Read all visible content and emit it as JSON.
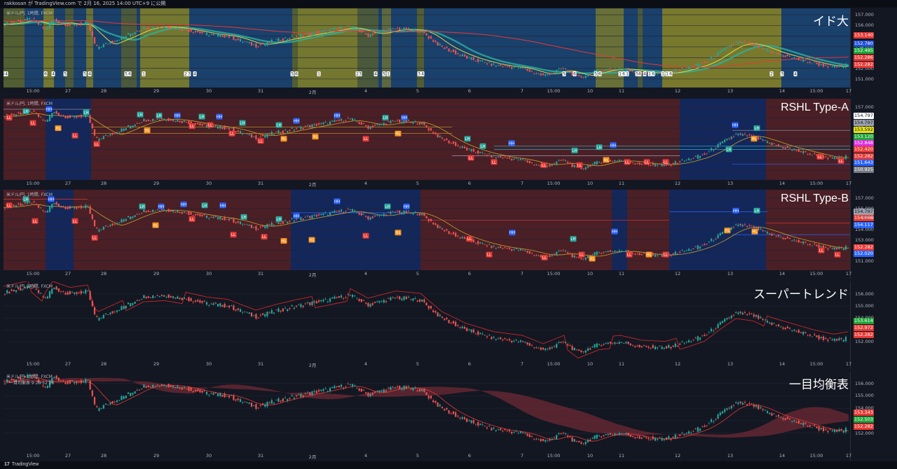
{
  "header": {
    "publish_text": "rakkosan が TradingView.com で 2月 16, 2025 14:00 UTC+9 に公開"
  },
  "footer": {
    "brand_mark": "17",
    "brand": "TradingView"
  },
  "x_axis": [
    "15:00",
    "27",
    "28",
    "29",
    "30",
    "31",
    "2月",
    "4",
    "5",
    "6",
    "7",
    "15:00",
    "10",
    "11",
    "12",
    "13",
    "14",
    "15:00",
    "17"
  ],
  "panes": [
    {
      "title": "イド大",
      "symbol": "米ドル/円, 1時間, FXCM",
      "y_ticks": [
        "157.000",
        "156.000",
        "155.000",
        "154.000",
        "153.000",
        "152.000",
        "151.000"
      ],
      "price_tags": [
        {
          "value": "153.140",
          "color": "#e53935"
        },
        {
          "value": "152.780",
          "color": "#1e4fd8"
        },
        {
          "value": "152.495",
          "color": "#22a33a"
        },
        {
          "value": "152.286",
          "color": "#e53935"
        },
        {
          "value": "152.282",
          "color": "#e53935"
        }
      ],
      "markers": [
        {
          "t": 1,
          "label": "4"
        },
        {
          "t": 4,
          "label": "4"
        },
        {
          "t": 60,
          "label": "6"
        },
        {
          "t": 71,
          "label": "4"
        },
        {
          "t": 88,
          "label": "5"
        },
        {
          "t": 116,
          "label": "5"
        },
        {
          "t": 123,
          "label": "4"
        },
        {
          "t": 175,
          "label": "5"
        },
        {
          "t": 180,
          "label": "6"
        },
        {
          "t": 200,
          "label": "1"
        },
        {
          "t": 260,
          "label": "2"
        },
        {
          "t": 265,
          "label": "3"
        },
        {
          "t": 273,
          "label": "4"
        },
        {
          "t": 412,
          "label": "5"
        },
        {
          "t": 418,
          "label": "6"
        },
        {
          "t": 450,
          "label": "1"
        },
        {
          "t": 505,
          "label": "2"
        },
        {
          "t": 509,
          "label": "3"
        },
        {
          "t": 531,
          "label": "4"
        },
        {
          "t": 543,
          "label": "5"
        },
        {
          "t": 549,
          "label": "1"
        },
        {
          "t": 593,
          "label": "3"
        },
        {
          "t": 598,
          "label": "4"
        },
        {
          "t": 800,
          "label": "5"
        },
        {
          "t": 815,
          "label": "6"
        },
        {
          "t": 845,
          "label": "5"
        },
        {
          "t": 851,
          "label": "6"
        },
        {
          "t": 880,
          "label": "1"
        },
        {
          "t": 885,
          "label": "6"
        },
        {
          "t": 890,
          "label": "1"
        },
        {
          "t": 904,
          "label": "5"
        },
        {
          "t": 908,
          "label": "6"
        },
        {
          "t": 915,
          "label": "4"
        },
        {
          "t": 922,
          "label": "1"
        },
        {
          "t": 927,
          "label": "6"
        },
        {
          "t": 941,
          "label": "1"
        },
        {
          "t": 947,
          "label": "1"
        },
        {
          "t": 952,
          "label": "6"
        },
        {
          "t": 1096,
          "label": "2"
        },
        {
          "t": 1111,
          "label": "3"
        },
        {
          "t": 1130,
          "label": "4"
        }
      ]
    },
    {
      "title": "RSHL Type-A",
      "symbol": "米ドル/円, 1時間, FXCM",
      "y_ticks": [
        "157.000",
        "156.000",
        "155.000",
        "154.000",
        "153.000",
        "152.000",
        "151.000"
      ],
      "price_tags": [
        {
          "value": "154.797",
          "color": "#ffffff",
          "text": "#131722"
        },
        {
          "value": "154.797",
          "color": "#9aa0ac",
          "text": "#131722"
        },
        {
          "value": "153.592",
          "color": "#e6e21a",
          "text": "#131722"
        },
        {
          "value": "153.120",
          "color": "#22a33a"
        },
        {
          "value": "152.848",
          "color": "#d930d9"
        },
        {
          "value": "152.420",
          "color": "#e53935"
        },
        {
          "value": "152.282",
          "color": "#e53935"
        },
        {
          "value": "151.643",
          "color": "#2962ff"
        },
        {
          "value": "150.925",
          "color": "#787b86"
        }
      ],
      "labels": [
        {
          "t": 8,
          "y": 156.0,
          "text": "LL"
        },
        {
          "t": 32,
          "y": 156.6,
          "text": "LH"
        },
        {
          "t": 42,
          "y": 155.5,
          "text": "LL"
        },
        {
          "t": 65,
          "y": 156.8,
          "text": "HH"
        },
        {
          "t": 78,
          "y": 155.0,
          "text": "HL"
        },
        {
          "t": 102,
          "y": 154.3,
          "text": "LL"
        },
        {
          "t": 118,
          "y": 156.5,
          "text": "LH"
        },
        {
          "t": 133,
          "y": 153.5,
          "text": "LL"
        },
        {
          "t": 195,
          "y": 156.3,
          "text": "LH"
        },
        {
          "t": 205,
          "y": 154.8,
          "text": "HL"
        },
        {
          "t": 222,
          "y": 156.2,
          "text": "LH"
        },
        {
          "t": 248,
          "y": 156.2,
          "text": "HH"
        },
        {
          "t": 269,
          "y": 155.2,
          "text": "LL"
        },
        {
          "t": 283,
          "y": 156.1,
          "text": "LH"
        },
        {
          "t": 295,
          "y": 155.3,
          "text": "LL"
        },
        {
          "t": 308,
          "y": 156.1,
          "text": "HH"
        },
        {
          "t": 326,
          "y": 154.5,
          "text": "LL"
        },
        {
          "t": 341,
          "y": 155.5,
          "text": "LH"
        },
        {
          "t": 367,
          "y": 153.8,
          "text": "LL"
        },
        {
          "t": 393,
          "y": 155.3,
          "text": "LH"
        },
        {
          "t": 400,
          "y": 154.0,
          "text": "HL"
        },
        {
          "t": 418,
          "y": 155.7,
          "text": "HH"
        },
        {
          "t": 445,
          "y": 154.2,
          "text": "HL"
        },
        {
          "t": 476,
          "y": 156.2,
          "text": "HH"
        },
        {
          "t": 517,
          "y": 154.0,
          "text": "LL"
        },
        {
          "t": 545,
          "y": 156.0,
          "text": "LH"
        },
        {
          "t": 563,
          "y": 154.5,
          "text": "HL"
        },
        {
          "t": 572,
          "y": 156.0,
          "text": "HH"
        },
        {
          "t": 662,
          "y": 154.0,
          "text": "LH"
        },
        {
          "t": 667,
          "y": 152.2,
          "text": "LL"
        },
        {
          "t": 684,
          "y": 153.3,
          "text": "LH"
        },
        {
          "t": 700,
          "y": 151.8,
          "text": "LL"
        },
        {
          "t": 725,
          "y": 153.6,
          "text": "HH"
        },
        {
          "t": 771,
          "y": 151.5,
          "text": "LL"
        },
        {
          "t": 815,
          "y": 152.9,
          "text": "LH"
        },
        {
          "t": 822,
          "y": 151.5,
          "text": "LL"
        },
        {
          "t": 850,
          "y": 153.2,
          "text": "LH"
        },
        {
          "t": 860,
          "y": 152.0,
          "text": "HL"
        },
        {
          "t": 870,
          "y": 153.4,
          "text": "HH"
        },
        {
          "t": 890,
          "y": 151.8,
          "text": "LL"
        },
        {
          "t": 918,
          "y": 151.8,
          "text": "LL"
        },
        {
          "t": 945,
          "y": 151.8,
          "text": "LL"
        },
        {
          "t": 1044,
          "y": 155.3,
          "text": "HH"
        },
        {
          "t": 1035,
          "y": 153.0,
          "text": "LH"
        },
        {
          "t": 1071,
          "y": 154.0,
          "text": "HL"
        },
        {
          "t": 1075,
          "y": 155.0,
          "text": "LH"
        },
        {
          "t": 1165,
          "y": 152.3,
          "text": "LL"
        },
        {
          "t": 1195,
          "y": 151.9,
          "text": "LL"
        }
      ]
    },
    {
      "title": "RSHL Type-B",
      "symbol": "米ドル/円, 1時間, FXCM",
      "y_ticks": [
        "157.000",
        "156.000",
        "155.000",
        "154.000",
        "153.000",
        "152.000",
        "151.000"
      ],
      "price_tags": [
        {
          "value": "154.797",
          "color": "#9aa0ac",
          "text": "#131722"
        },
        {
          "value": "154.666",
          "color": "#e53935"
        },
        {
          "value": "154.117",
          "color": "#2962ff"
        },
        {
          "value": "152.282",
          "color": "#e53935"
        },
        {
          "value": "152.020",
          "color": "#2962ff"
        }
      ],
      "cursor_value": "238.4",
      "labels": [
        {
          "t": 8,
          "y": 156.3,
          "text": "LL"
        },
        {
          "t": 32,
          "y": 156.9,
          "text": "LH"
        },
        {
          "t": 45,
          "y": 154.8,
          "text": "LL"
        },
        {
          "t": 68,
          "y": 156.9,
          "text": "HH"
        },
        {
          "t": 102,
          "y": 154.8,
          "text": "LL"
        },
        {
          "t": 130,
          "y": 153.2,
          "text": "LL"
        },
        {
          "t": 198,
          "y": 156.2,
          "text": "LH"
        },
        {
          "t": 217,
          "y": 154.4,
          "text": "HL"
        },
        {
          "t": 225,
          "y": 156.2,
          "text": "HH"
        },
        {
          "t": 257,
          "y": 156.4,
          "text": "HH"
        },
        {
          "t": 269,
          "y": 155.0,
          "text": "LL"
        },
        {
          "t": 287,
          "y": 156.3,
          "text": "LH"
        },
        {
          "t": 313,
          "y": 156.3,
          "text": "HH"
        },
        {
          "t": 328,
          "y": 153.5,
          "text": "LL"
        },
        {
          "t": 343,
          "y": 155.2,
          "text": "LH"
        },
        {
          "t": 372,
          "y": 153.3,
          "text": "LL"
        },
        {
          "t": 393,
          "y": 155.0,
          "text": "LH"
        },
        {
          "t": 400,
          "y": 152.9,
          "text": "HL"
        },
        {
          "t": 418,
          "y": 155.3,
          "text": "HH"
        },
        {
          "t": 440,
          "y": 153.0,
          "text": "HL"
        },
        {
          "t": 476,
          "y": 156.7,
          "text": "HH"
        },
        {
          "t": 517,
          "y": 153.4,
          "text": "LL"
        },
        {
          "t": 548,
          "y": 156.2,
          "text": "LH"
        },
        {
          "t": 563,
          "y": 153.7,
          "text": "HL"
        },
        {
          "t": 575,
          "y": 156.2,
          "text": "HH"
        },
        {
          "t": 665,
          "y": 153.1,
          "text": "LL"
        },
        {
          "t": 693,
          "y": 151.6,
          "text": "LL"
        },
        {
          "t": 726,
          "y": 153.7,
          "text": "HH"
        },
        {
          "t": 772,
          "y": 151.3,
          "text": "LL"
        },
        {
          "t": 813,
          "y": 153.1,
          "text": "LH"
        },
        {
          "t": 825,
          "y": 151.6,
          "text": "LL"
        },
        {
          "t": 840,
          "y": 151.2,
          "text": "HL"
        },
        {
          "t": 872,
          "y": 153.8,
          "text": "HH"
        },
        {
          "t": 893,
          "y": 151.6,
          "text": "LL"
        },
        {
          "t": 921,
          "y": 151.6,
          "text": "HL"
        },
        {
          "t": 945,
          "y": 151.6,
          "text": "LL"
        },
        {
          "t": 1045,
          "y": 155.8,
          "text": "HH"
        },
        {
          "t": 1033,
          "y": 153.9,
          "text": "HL"
        },
        {
          "t": 1072,
          "y": 153.8,
          "text": "HL"
        },
        {
          "t": 1075,
          "y": 155.8,
          "text": "LH"
        },
        {
          "t": 1167,
          "y": 152.0,
          "text": "LL"
        },
        {
          "t": 1190,
          "y": 151.6,
          "text": "LL"
        }
      ]
    },
    {
      "title": "スーパートレンド",
      "symbol": "米ドル/円, 1時間, FXCM",
      "y_ticks": [
        "156.000",
        "155.000",
        "154.000",
        "153.000",
        "152.000"
      ],
      "price_tags": [
        {
          "value": "153.614",
          "color": "#22a33a"
        },
        {
          "value": "152.972",
          "color": "#e53935"
        },
        {
          "value": "152.282",
          "color": "#e53935"
        }
      ]
    },
    {
      "title": "一目均衡表",
      "symbol": "米ドル/円, 1時間, FXCM",
      "symbol2": "一目均衡表 9 26 52 26",
      "y_ticks": [
        "156.000",
        "155.000",
        "154.000",
        "153.000",
        "152.000"
      ],
      "price_tags": [
        {
          "value": "153.343",
          "color": "#e53935"
        },
        {
          "value": "152.503",
          "color": "#22a33a"
        },
        {
          "value": "152.282",
          "color": "#e53935"
        }
      ]
    }
  ],
  "colors": {
    "bg": "#131722",
    "up": "#26a69a",
    "down": "#ef5350",
    "blue_zone": "#1e3a5f",
    "olive_zone": "#6b6a1a",
    "red_zone": "#4a1f26",
    "navy_zone": "#14275a"
  }
}
